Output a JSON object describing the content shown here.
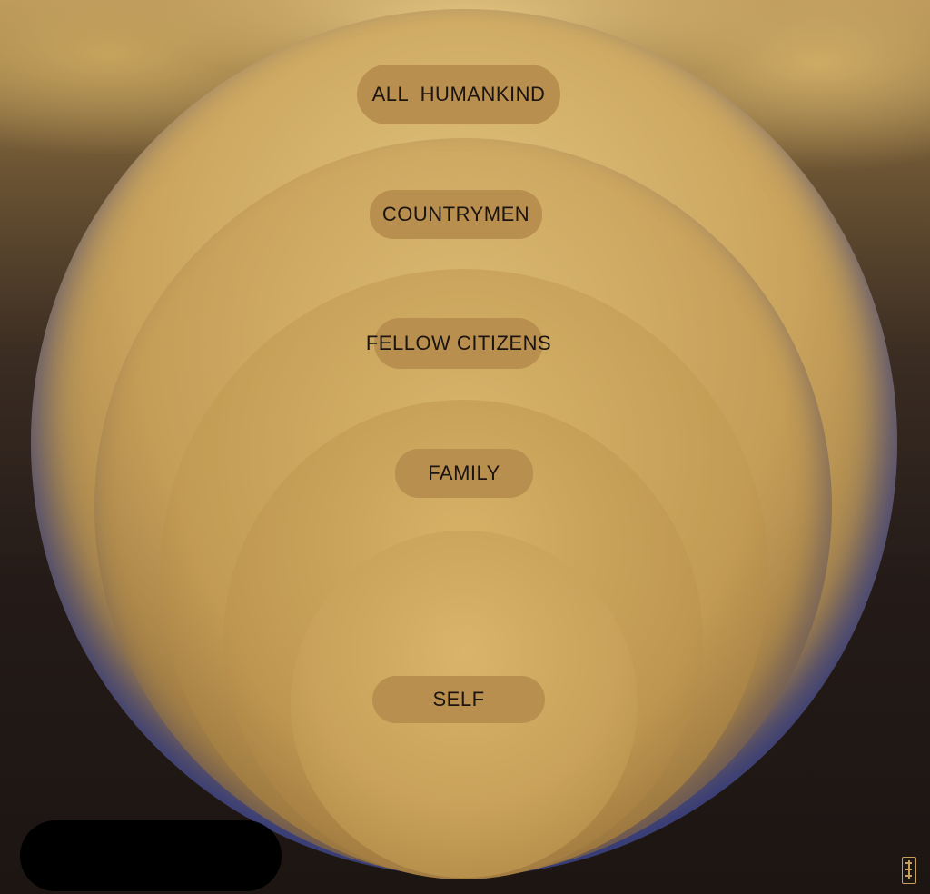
{
  "diagram": {
    "rings": [
      {
        "id": "ring-1",
        "label": "ALL  HUMANKIND"
      },
      {
        "id": "ring-2",
        "label": "COUNTRYMEN"
      },
      {
        "id": "ring-3",
        "label": "FELLOW CITIZENS"
      },
      {
        "id": "ring-4",
        "label": "FAMILY"
      },
      {
        "id": "ring-5",
        "label": "SELF"
      }
    ]
  },
  "colors": {
    "label_pill": "#b88f4f",
    "label_text": "#1c1410",
    "circle_gold": "#c9a35c",
    "background_dark": "#1c1512"
  },
  "icons": {
    "seal": "artist-seal-icon",
    "redaction": "redaction-block"
  }
}
